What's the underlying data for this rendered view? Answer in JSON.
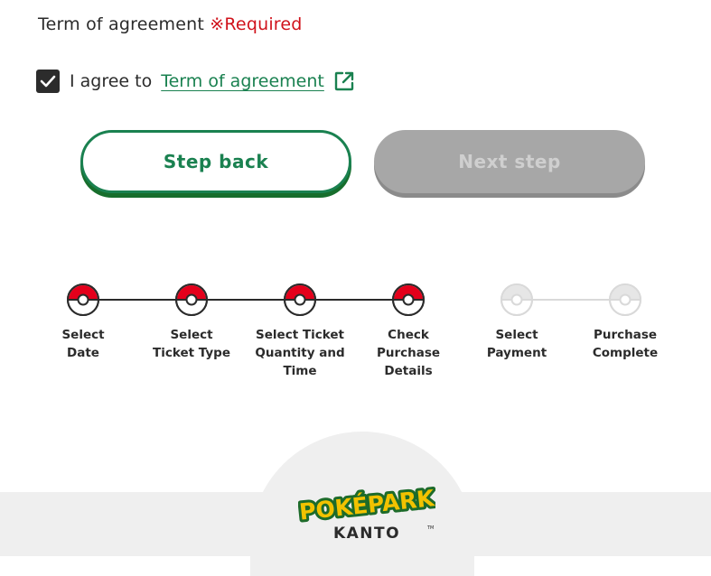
{
  "agreement": {
    "title": "Term of agreement",
    "required": "※Required",
    "checked": true,
    "agree_prefix": "I agree to",
    "link_label": "Term of agreement"
  },
  "buttons": {
    "back_label": "Step back",
    "next_label": "Next step"
  },
  "steps": [
    {
      "line1": "Select",
      "line2": "Date",
      "line3": "",
      "done": true
    },
    {
      "line1": "Select",
      "line2": "Ticket Type",
      "line3": "",
      "done": true
    },
    {
      "line1": "Select Ticket",
      "line2": "Quantity and",
      "line3": "Time",
      "done": true
    },
    {
      "line1": "Check",
      "line2": "Purchase",
      "line3": "Details",
      "done": true
    },
    {
      "line1": "Select",
      "line2": "Payment",
      "line3": "",
      "done": false
    },
    {
      "line1": "Purchase",
      "line2": "Complete",
      "line3": "",
      "done": false
    }
  ],
  "logo": {
    "line1": "POKÉPARK",
    "line2": "KANTO",
    "trademark": "TM"
  },
  "colors": {
    "accent": "#1a8150",
    "required": "#d0121b",
    "pokeball_red": "#e4001b",
    "inactive": "#d9d9d9"
  }
}
